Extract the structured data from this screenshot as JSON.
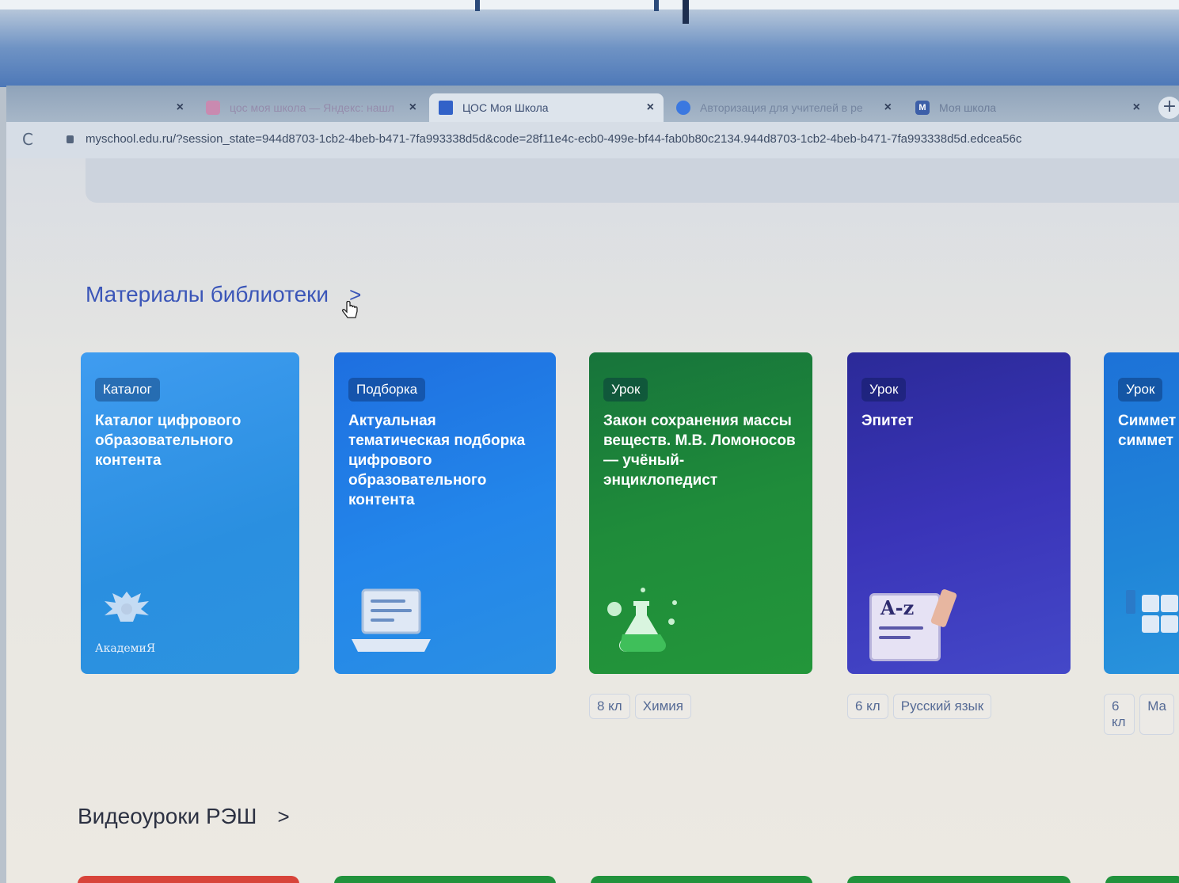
{
  "browser": {
    "tabs": [
      {
        "title": "",
        "favicon": "blank-favicon",
        "active": false
      },
      {
        "title": "цос моя школа — Яндекс: нашл",
        "favicon": "yandex-favicon",
        "active": false
      },
      {
        "title": "ЦОС Моя Школа",
        "favicon": "myschool-favicon",
        "active": true
      },
      {
        "title": "Авторизация для учителей в ре",
        "favicon": "auth-favicon",
        "active": false
      },
      {
        "title": "Моя школа",
        "favicon": "m-favicon",
        "favicon_letter": "M",
        "active": false
      }
    ],
    "close_glyph": "×",
    "new_tab_glyph": "+",
    "reload_glyph": "C",
    "url": "myschool.edu.ru/?session_state=944d8703-1cb2-4beb-b471-7fa993338d5d&code=28f11e4c-ecb0-499e-bf44-fab0b80c2134.944d8703-1cb2-4beb-b471-7fa993338d5d.edcea56c"
  },
  "library": {
    "title": "Материалы библиотеки",
    "chevron": ">",
    "cards": [
      {
        "badge": "Каталог",
        "title": "Каталог цифрового образовательного контента",
        "icon": "academy-emblem-icon",
        "logo_text": "АкадемиЯ",
        "color": "#2b8fe0"
      },
      {
        "badge": "Подборка",
        "title": "Актуальная тематическая подборка цифрового образовательного контента",
        "icon": "laptop-icon",
        "color": "#1f78e6"
      },
      {
        "badge": "Урок",
        "title": "Закон сохранения массы веществ. М.В. Ломоносов — учёный-энциклопедист",
        "icon": "flask-icon",
        "color": "#1f8a3a",
        "grade": "8 кл",
        "subject": "Химия"
      },
      {
        "badge": "Урок",
        "title": "Эпитет",
        "icon": "alphabet-scroll-icon",
        "icon_text": "A-z",
        "color": "#3b2fb8",
        "grade": "6 кл",
        "subject": "Русский язык"
      },
      {
        "badge": "Урок",
        "title": "Симмет симмет",
        "icon": "math-icon",
        "color": "#1f86d8",
        "grade": "6 кл",
        "subject": "Ма"
      }
    ]
  },
  "video": {
    "title": "Видеоуроки РЭШ",
    "chevron": ">"
  }
}
